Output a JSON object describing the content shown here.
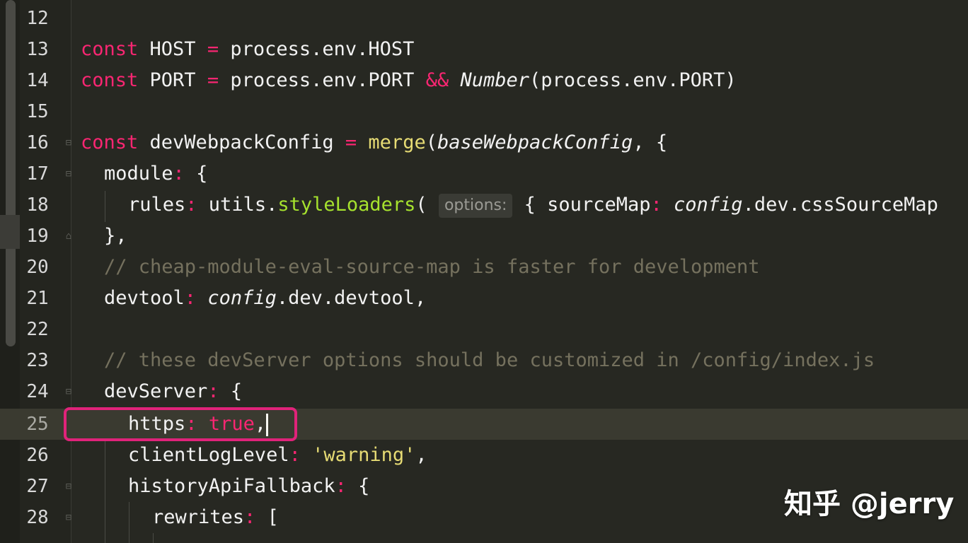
{
  "lines": [
    {
      "n": "12"
    },
    {
      "n": "13",
      "a": "const",
      "b": " HOST ",
      "c": "=",
      "d": " process.env.HOST"
    },
    {
      "n": "14",
      "a": "const",
      "b": " PORT ",
      "c": "=",
      "d": " process.env.PORT ",
      "e": "&&",
      "f": " ",
      "g": "Number",
      "h": "(process.env.PORT)"
    },
    {
      "n": "15"
    },
    {
      "n": "16",
      "a": "const",
      "b": " devWebpackConfig ",
      "c": "=",
      "d": " ",
      "e": "merge",
      "f": "(",
      "g": "baseWebpackConfig",
      "h": ", {"
    },
    {
      "n": "17",
      "a": "module",
      "b": ":",
      "c": " {"
    },
    {
      "n": "18",
      "a": "rules",
      "b": ":",
      "c": " utils.",
      "d": "styleLoaders",
      "e": "(",
      "f": "options:",
      "g": " { sourceMap",
      "h": ":",
      "i": " ",
      "j": "config",
      ".k": "",
      "k": ".dev.cssSourceMap"
    },
    {
      "n": "19",
      "a": "},"
    },
    {
      "n": "20",
      "a": "// cheap-module-eval-source-map is faster for development"
    },
    {
      "n": "21",
      "a": "devtool",
      "b": ":",
      "c": " ",
      "d": "config",
      "e": ".dev.devtool,"
    },
    {
      "n": "22"
    },
    {
      "n": "23",
      "a": "// these devServer options should be customized in /config/index.js"
    },
    {
      "n": "24",
      "a": "devServer",
      "b": ":",
      "c": " {"
    },
    {
      "n": "25",
      "a": "https",
      "b": ":",
      "c": " ",
      "d": "true",
      "e": ","
    },
    {
      "n": "26",
      "a": "clientLogLevel",
      "b": ":",
      "c": " ",
      "d": "'warning'",
      "e": ","
    },
    {
      "n": "27",
      "a": "historyApiFallback",
      "b": ":",
      "c": " {"
    },
    {
      "n": "28",
      "a": "rewrites",
      "b": ":",
      "c": " ["
    }
  ],
  "watermark": "知乎 @jerry",
  "colors": {
    "background": "#272822",
    "keyword": "#f92672",
    "function": "#e6db74",
    "comment": "#75715e",
    "highlight": "#e0237a"
  }
}
